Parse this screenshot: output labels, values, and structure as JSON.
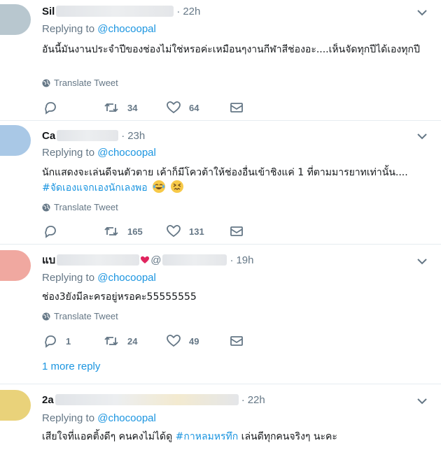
{
  "tweets": [
    {
      "name": "Sil",
      "time": "22h",
      "replying_label": "Replying to",
      "replying_handle": "@chocoopal",
      "text": "อันนี้มันงานประจำปีของช่องไม่ใช่หรอค่ะเหมือนๆงานกีฬาสีช่องอะ....เห็นจัดทุกปีได้เองทุกปี",
      "translate": "Translate Tweet",
      "replies": "",
      "retweets": "34",
      "likes": "64",
      "avatar_color": "#b8c7cf"
    },
    {
      "name": "Ca",
      "time": "23h",
      "replying_label": "Replying to",
      "replying_handle": "@chocoopal",
      "text": "นักแสดงจะเล่นดีจนตัวตาย เค้าก็มีโควต้าให้ช่องอื่นเข้าชิงแค่ 1 ที่ตามมารยาทเท่านั้น....",
      "hashtag": "#จัดเองแจกเองนักเลงพอ",
      "emojis": [
        "face-with-tears-of-joy",
        "confounded-face"
      ],
      "translate": "Translate Tweet",
      "replies": "",
      "retweets": "165",
      "likes": "131",
      "avatar_color": "#a9c8e6"
    },
    {
      "name": "แบ",
      "handle_partial": "@",
      "time": "19h",
      "replying_label": "Replying to",
      "replying_handle": "@chocoopal",
      "text": "ช่อง3ยังมีละครอยู่หรอคะ55555555",
      "translate": "Translate Tweet",
      "replies": "1",
      "retweets": "24",
      "likes": "49",
      "avatar_color": "#f0a8a0",
      "more_reply": "1 more reply"
    },
    {
      "name": "2a",
      "time": "22h",
      "replying_label": "Replying to",
      "replying_handle": "@chocoopal",
      "text_before": "เสียใจที่แอคติ้งดีๆ คนคงไม่ได้ดู ",
      "hashtag": "#กาหลมหรทึก",
      "text_after": " เล่นดีทุกคนจริงๆ นะคะ",
      "avatar_color": "#e9d27a"
    }
  ],
  "icons": {
    "reply": "reply-icon",
    "retweet": "retweet-icon",
    "like": "heart-icon",
    "dm": "envelope-icon",
    "globe": "globe-icon",
    "more": "chevron-down-icon"
  }
}
